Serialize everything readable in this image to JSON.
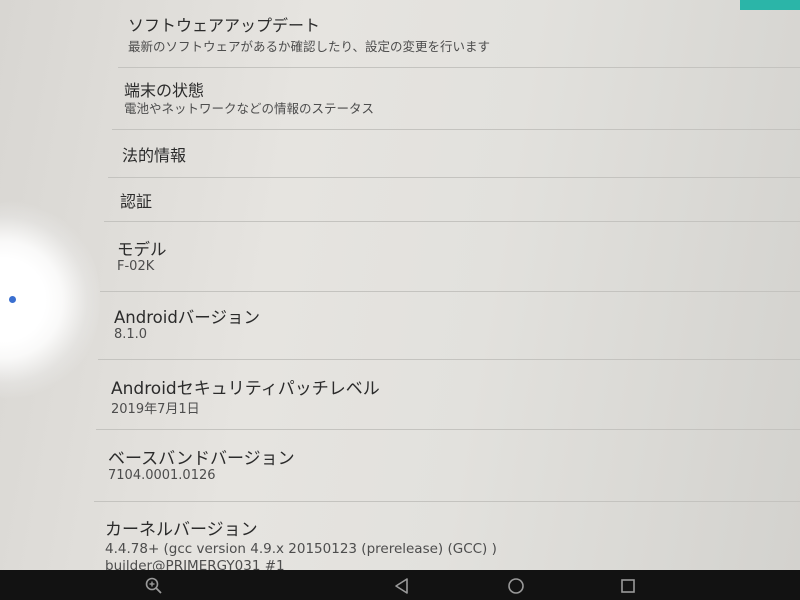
{
  "settings": {
    "items": [
      {
        "title": "ソフトウェアアップデート",
        "subtitle": "最新のソフトウェアがあるか確認したり、設定の変更を行います"
      },
      {
        "title": "端末の状態",
        "subtitle": "電池やネットワークなどの情報のステータス"
      },
      {
        "title": "法的情報",
        "subtitle": ""
      },
      {
        "title": "認証",
        "subtitle": ""
      },
      {
        "title": "モデル",
        "subtitle": "F-02K"
      },
      {
        "title": "Androidバージョン",
        "subtitle": "8.1.0"
      },
      {
        "title": "Androidセキュリティパッチレベル",
        "subtitle": "2019年7月1日"
      },
      {
        "title": "ベースバンドバージョン",
        "subtitle": "7104.0001.0126"
      },
      {
        "title": "カーネルバージョン",
        "subtitle": "4.4.78+ (gcc version 4.9.x 20150123 (prerelease) (GCC) )",
        "subtitle2": "builder@PRIMERGY031 #1"
      }
    ]
  },
  "navbar": {
    "icons": [
      "zoom-icon",
      "back-icon",
      "home-icon",
      "recents-icon"
    ]
  },
  "colors": {
    "accent": "#2bb5a8",
    "navbar": "#121212"
  }
}
